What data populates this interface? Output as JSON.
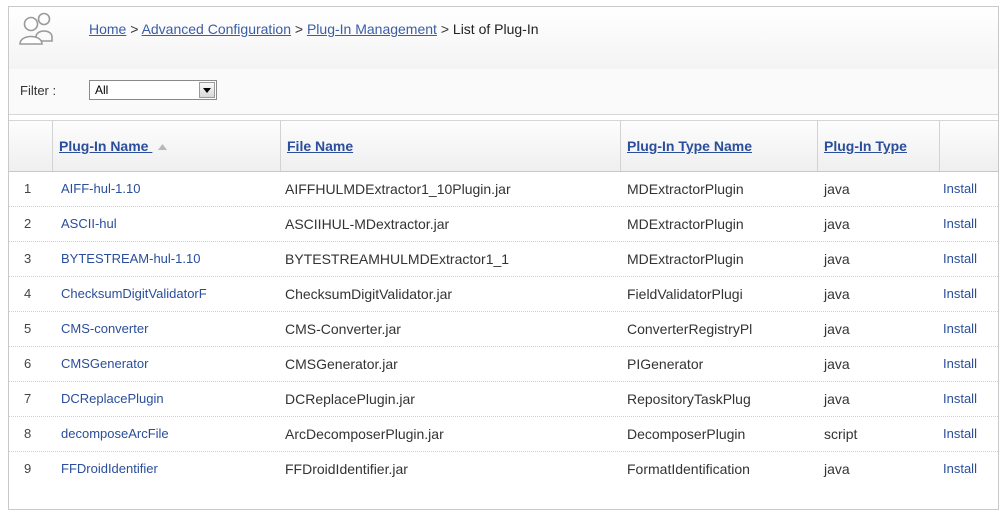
{
  "breadcrumb": {
    "home": "Home",
    "sep1": ">",
    "advanced": "Advanced Configuration",
    "sep2": ">",
    "plugin_mgmt": "Plug-In Management",
    "sep3": ">",
    "current": "List of Plug-In"
  },
  "filter": {
    "label": "Filter :",
    "value": "All"
  },
  "table": {
    "columns": [
      "Plug-In Name",
      "File Name",
      "Plug-In Type Name",
      "Plug-In Type",
      ""
    ],
    "rows": [
      {
        "num": "1",
        "name": "AIFF-hul-1.10",
        "file": "AIFFHULMDExtractor1_10Plugin.jar",
        "type_name": "MDExtractorPlugin",
        "type": "java",
        "action": "Install"
      },
      {
        "num": "2",
        "name": "ASCII-hul",
        "file": "ASCIIHUL-MDextractor.jar",
        "type_name": "MDExtractorPlugin",
        "type": "java",
        "action": "Install"
      },
      {
        "num": "3",
        "name": "BYTESTREAM-hul-1.10",
        "file": "BYTESTREAMHULMDExtractor1_1",
        "type_name": "MDExtractorPlugin",
        "type": "java",
        "action": "Install"
      },
      {
        "num": "4",
        "name": "ChecksumDigitValidatorF",
        "file": "ChecksumDigitValidator.jar",
        "type_name": "FieldValidatorPlugi",
        "type": "java",
        "action": "Install"
      },
      {
        "num": "5",
        "name": "CMS-converter",
        "file": "CMS-Converter.jar",
        "type_name": "ConverterRegistryPl",
        "type": "java",
        "action": "Install"
      },
      {
        "num": "6",
        "name": "CMSGenerator",
        "file": "CMSGenerator.jar",
        "type_name": "PIGenerator",
        "type": "java",
        "action": "Install"
      },
      {
        "num": "7",
        "name": "DCReplacePlugin",
        "file": "DCReplacePlugin.jar",
        "type_name": "RepositoryTaskPlug",
        "type": "java",
        "action": "Install"
      },
      {
        "num": "8",
        "name": "decomposeArcFile",
        "file": "ArcDecomposerPlugin.jar",
        "type_name": "DecomposerPlugin",
        "type": "script",
        "action": "Install"
      },
      {
        "num": "9",
        "name": "FFDroidIdentifier",
        "file": "FFDroidIdentifier.jar",
        "type_name": "FormatIdentification",
        "type": "java",
        "action": "Install"
      }
    ]
  }
}
